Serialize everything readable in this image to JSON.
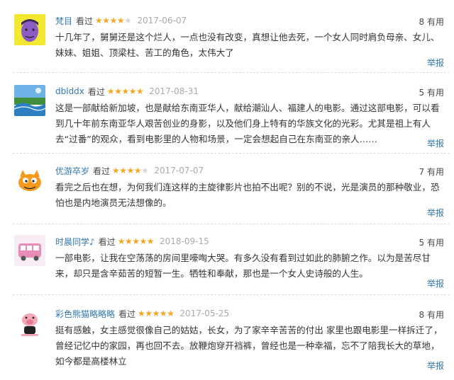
{
  "colors": {
    "link": "#3377aa",
    "star": "#f5a623",
    "date": "#aaaaaa"
  },
  "reviews": [
    {
      "user": "梵目",
      "seen": "看过",
      "rating": 4,
      "date": "2017-06-07",
      "useful_count": "8",
      "useful_label": "有用",
      "content": "十几年了，舅舅还是这个烂人，一点也没有改变，真想让他去死，一个女人同时肩负母亲、女儿、妹妹、姐姐、顶梁柱、苦工的角色，太伟大了",
      "report": "举报",
      "avatar_icon": "cartoon-face-icon"
    },
    {
      "user": "dblddx",
      "seen": "看过",
      "rating": 5,
      "date": "2017-08-31",
      "useful_count": "5",
      "useful_label": "有用",
      "content": "这是一部献给新加坡，也是献给东南亚华人，献给潮汕人、福建人的电影。通过这部电影，可以看到几十年前东南亚华人艰苦创业的身影，以及他们身上特有的华族文化的光彩。尤其是祖上有人去“过番”的观众，看到电影里的人物和场景，一定会想起自己在东南亚的亲人……",
      "report": "举报",
      "avatar_icon": "landscape-icon"
    },
    {
      "user": "优游卒岁",
      "seen": "看过",
      "rating": 4,
      "date": "2017-07-07",
      "useful_count": "7",
      "useful_label": "有用",
      "content": "看完之后也在想，为何我们连这样的主旋律影片也拍不出呢？别的不说，光是演员的那种敬业，恐怕也是内地演员无法想像的。",
      "report": "举报",
      "avatar_icon": "cartoon-cat-icon"
    },
    {
      "user": "时晨同学♪",
      "seen": "看过",
      "rating": 5,
      "date": "2018-09-15",
      "useful_count": "5",
      "useful_label": "有用",
      "content": "一部电影，让我在空荡荡的房间里嚎啕大哭。有多久没有看到过如此的肺腑之作。以为是苦尽甘来，却只是含辛茹苦的短暂一生。牺牲和奉献，那也是一个女人史诗般的人生。",
      "report": "举报",
      "avatar_icon": "pink-bus-icon"
    },
    {
      "user": "彩色熊猫略略略",
      "seen": "看过",
      "rating": 5,
      "date": "2017-05-25",
      "useful_count": "8",
      "useful_label": "有用",
      "content": "挺有感触，女主感觉很像自己的姑姑，长女，为了家辛辛苦苦的付出 家里也跟电影里一样拆迁了，曾经记忆中的家园，再也回不去。放鞭炮穿开裆裤，曾经也是一种幸福，忘不了陪我长大的草地，如今都是高楼林立",
      "report": "举报",
      "avatar_icon": "cartoon-pig-icon"
    }
  ]
}
